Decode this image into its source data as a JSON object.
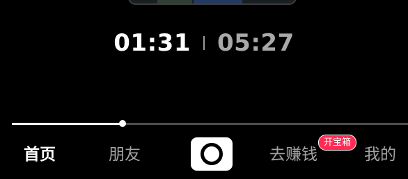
{
  "player": {
    "current_time": "01:31",
    "total_time": "05:27",
    "progress": 0.28
  },
  "tabbar": {
    "home_label": "首页",
    "friends_label": "朋友",
    "earn_label": "去赚钱",
    "earn_badge": "开宝箱",
    "me_label": "我的",
    "create_icon": "create-plus-ring-icon",
    "active_tab": "home"
  },
  "colors": {
    "background": "#000000",
    "text_active": "#ffffff",
    "text_inactive": "#a3a3a3",
    "badge": "#fe2c55",
    "progress_fill": "#ffffff",
    "progress_track": "#4e4e4e"
  }
}
